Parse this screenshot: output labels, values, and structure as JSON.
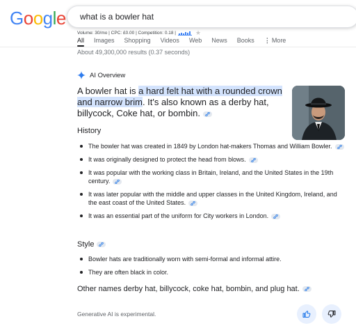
{
  "logo": {
    "letters": [
      "G",
      "o",
      "o",
      "g",
      "l",
      "e"
    ],
    "colors": [
      "#4285f4",
      "#ea4335",
      "#fbbc05",
      "#4285f4",
      "#34a853",
      "#ea4335"
    ]
  },
  "search": {
    "query": "what is a bowler hat"
  },
  "seo_bar": {
    "text": "Volume: 30/mo | CPC: £0.00 | Competition: 0.18 |"
  },
  "tabs": [
    {
      "label": "All",
      "active": true
    },
    {
      "label": "Images"
    },
    {
      "label": "Shopping"
    },
    {
      "label": "Videos"
    },
    {
      "label": "Web"
    },
    {
      "label": "News"
    },
    {
      "label": "Books"
    },
    {
      "label": "More"
    }
  ],
  "result_stats": "About 49,300,000 results (0.37 seconds)",
  "ai_overview": {
    "label": "AI Overview",
    "intro": {
      "before": "A bowler hat is ",
      "highlight": "a hard felt hat with a rounded crown and narrow brim",
      "after": ". It's also known as a derby hat, billycock, Coke hat, or bombin."
    },
    "history": {
      "title": "History",
      "items": [
        "The bowler hat was created in 1849 by London hat-makers Thomas and William Bowler.",
        "It was originally designed to protect the head from blows.",
        "It was popular with the working class in Britain, Ireland, and the United States in the 19th century.",
        "It was later popular with the middle and upper classes in the United Kingdom, Ireland, and the east coast of the United States.",
        "It was an essential part of the uniform for City workers in London."
      ]
    },
    "style": {
      "title": "Style",
      "items": [
        "Bowler hats are traditionally worn with semi-formal and informal attire.",
        "They are often black in color."
      ]
    },
    "other_names": "Other names derby hat, billycock, coke hat, bombin, and plug hat.",
    "footer": "Generative AI is experimental."
  },
  "colors": {
    "highlight": "#d3e3fd",
    "accent": "#1a73e8",
    "chip": "#e3e8ef"
  }
}
